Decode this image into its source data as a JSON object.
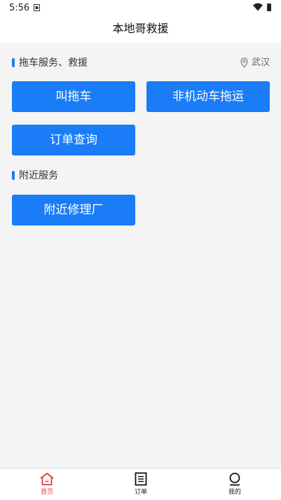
{
  "status": {
    "time": "5:56"
  },
  "header": {
    "title": "本地哥救援"
  },
  "section_tow": {
    "label": "拖车服务、救援",
    "location": "武汉"
  },
  "buttons": {
    "call_tow": "叫拖车",
    "nonmotor_tow": "非机动车拖运",
    "order_query": "订单查询",
    "nearby_repair": "附近修理厂"
  },
  "section_nearby": {
    "label": "附近服务"
  },
  "tabs": [
    {
      "label": "首页",
      "icon": "home-icon"
    },
    {
      "label": "订单",
      "icon": "order-list-icon"
    },
    {
      "label": "我的",
      "icon": "profile-icon"
    }
  ],
  "colors": {
    "accent": "#1a7cf7",
    "tab_active": "#e23a3a"
  }
}
